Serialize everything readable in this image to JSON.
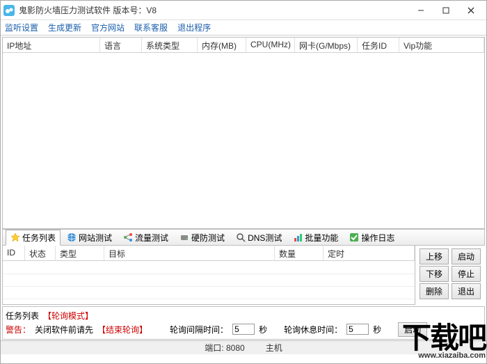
{
  "window": {
    "title": "鬼影防火墙压力测试软件 版本号：V8"
  },
  "menu": {
    "items": [
      "监听设置",
      "生成更新",
      "官方网站",
      "联系客服",
      "退出程序"
    ]
  },
  "topgrid": {
    "headers": [
      "IP地址",
      "语言",
      "系统类型",
      "内存(MB)",
      "CPU(MHz)",
      "网卡(G/Mbps)",
      "任务ID",
      "Vip功能"
    ]
  },
  "tabs": {
    "items": [
      {
        "icon": "star-icon",
        "label": "任务列表"
      },
      {
        "icon": "globe-icon",
        "label": "网站测试"
      },
      {
        "icon": "share-icon",
        "label": "流量测试"
      },
      {
        "icon": "disk-icon",
        "label": "硬防测试"
      },
      {
        "icon": "search-icon",
        "label": "DNS测试"
      },
      {
        "icon": "chart-icon",
        "label": "批量功能"
      },
      {
        "icon": "check-icon",
        "label": "操作日志"
      }
    ]
  },
  "taskgrid": {
    "headers": [
      "ID",
      "状态",
      "类型",
      "目标",
      "数量",
      "定时"
    ]
  },
  "sidebuttons": {
    "r1a": "上移",
    "r1b": "启动",
    "r2a": "下移",
    "r2b": "停止",
    "r3a": "删除",
    "r3b": "退出"
  },
  "footer": {
    "tasklist_label": "任务列表",
    "mode_label": "【轮询模式】",
    "warn_label": "警告：",
    "warn_text1": "关闭软件前请先",
    "warn_text2": "【结束轮询】",
    "interval_label": "轮询间隔时间：",
    "interval_val": "5",
    "interval_unit": "秒",
    "rest_label": "轮询休息时间：",
    "rest_val": "5",
    "rest_unit": "秒",
    "start_btn": "启动"
  },
  "status": {
    "port_label": "端口:",
    "port_val": "8080",
    "host_label": "主机"
  },
  "watermark": {
    "big": "下载吧",
    "small": "www.xiazaiba.com"
  }
}
